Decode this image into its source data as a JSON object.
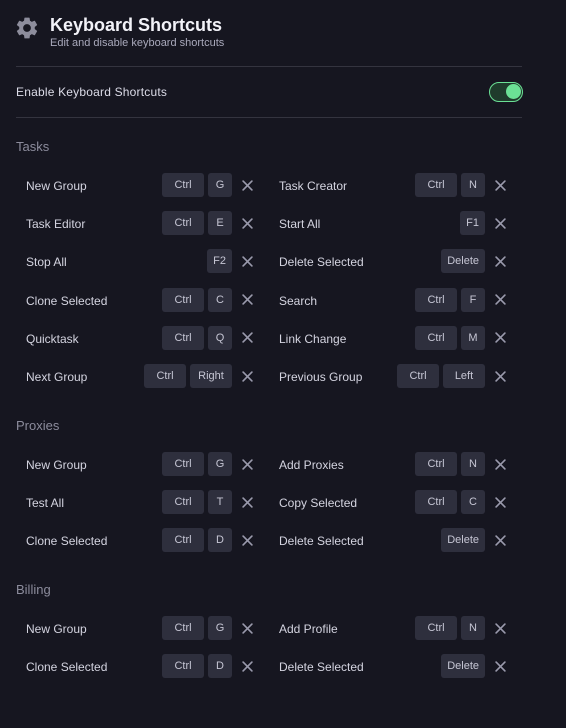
{
  "header": {
    "title": "Keyboard Shortcuts",
    "subtitle": "Edit and disable keyboard shortcuts",
    "icon": "gear-icon"
  },
  "enable": {
    "label": "Enable Keyboard Shortcuts",
    "enabled": true,
    "accent": "#6be095"
  },
  "sections": {
    "tasks": {
      "title": "Tasks",
      "items": [
        {
          "label": "New Group",
          "keys": [
            "Ctrl",
            "G"
          ]
        },
        {
          "label": "Task Creator",
          "keys": [
            "Ctrl",
            "N"
          ]
        },
        {
          "label": "Task Editor",
          "keys": [
            "Ctrl",
            "E"
          ]
        },
        {
          "label": "Start All",
          "keys": [
            "F1"
          ]
        },
        {
          "label": "Stop All",
          "keys": [
            "F2"
          ]
        },
        {
          "label": "Delete Selected",
          "keys": [
            "Delete"
          ]
        },
        {
          "label": "Clone Selected",
          "keys": [
            "Ctrl",
            "C"
          ]
        },
        {
          "label": "Search",
          "keys": [
            "Ctrl",
            "F"
          ]
        },
        {
          "label": "Quicktask",
          "keys": [
            "Ctrl",
            "Q"
          ]
        },
        {
          "label": "Link Change",
          "keys": [
            "Ctrl",
            "M"
          ]
        },
        {
          "label": "Next Group",
          "keys": [
            "Ctrl",
            "Right"
          ]
        },
        {
          "label": "Previous Group",
          "keys": [
            "Ctrl",
            "Left"
          ]
        }
      ]
    },
    "proxies": {
      "title": "Proxies",
      "items": [
        {
          "label": "New Group",
          "keys": [
            "Ctrl",
            "G"
          ]
        },
        {
          "label": "Add Proxies",
          "keys": [
            "Ctrl",
            "N"
          ]
        },
        {
          "label": "Test All",
          "keys": [
            "Ctrl",
            "T"
          ]
        },
        {
          "label": "Copy Selected",
          "keys": [
            "Ctrl",
            "C"
          ]
        },
        {
          "label": "Clone Selected",
          "keys": [
            "Ctrl",
            "D"
          ]
        },
        {
          "label": "Delete Selected",
          "keys": [
            "Delete"
          ]
        }
      ]
    },
    "billing": {
      "title": "Billing",
      "items": [
        {
          "label": "New Group",
          "keys": [
            "Ctrl",
            "G"
          ]
        },
        {
          "label": "Add Profile",
          "keys": [
            "Ctrl",
            "N"
          ]
        },
        {
          "label": "Clone Selected",
          "keys": [
            "Ctrl",
            "D"
          ]
        },
        {
          "label": "Delete Selected",
          "keys": [
            "Delete"
          ]
        }
      ]
    }
  }
}
